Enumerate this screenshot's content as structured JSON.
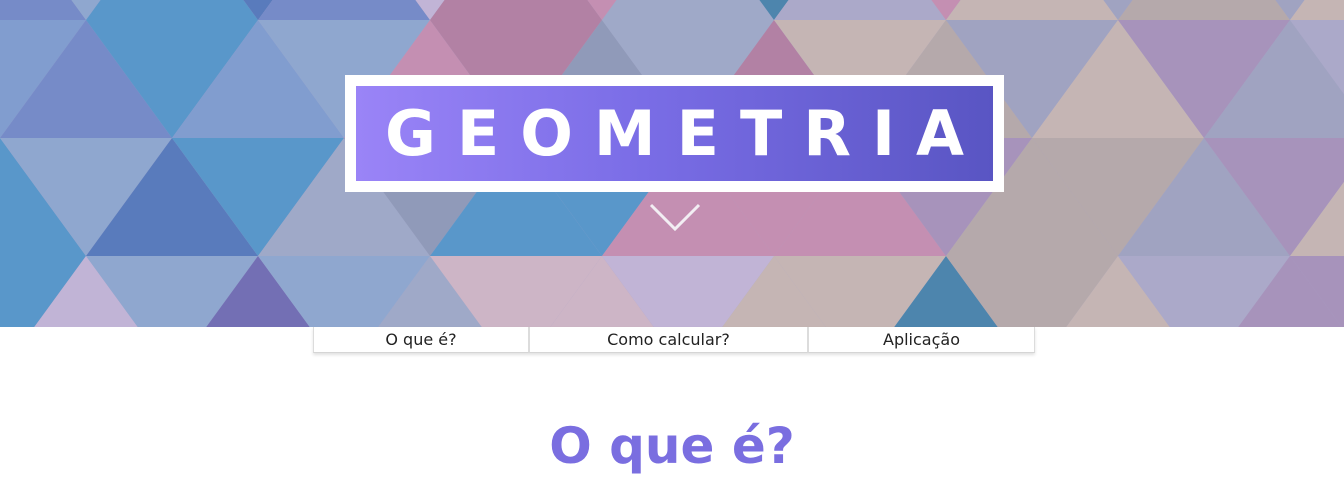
{
  "hero": {
    "title": "GEOMETRIA",
    "scroll_icon": "chevron-down-icon"
  },
  "nav": {
    "items": [
      {
        "label": "O que é?"
      },
      {
        "label": "Como calcular?"
      },
      {
        "label": "Aplicação"
      }
    ]
  },
  "section": {
    "title": "O que é?"
  },
  "colors": {
    "accent": "#7a6ee0",
    "title_gradient_start": "#9a84f7",
    "title_gradient_end": "#5955c3"
  }
}
